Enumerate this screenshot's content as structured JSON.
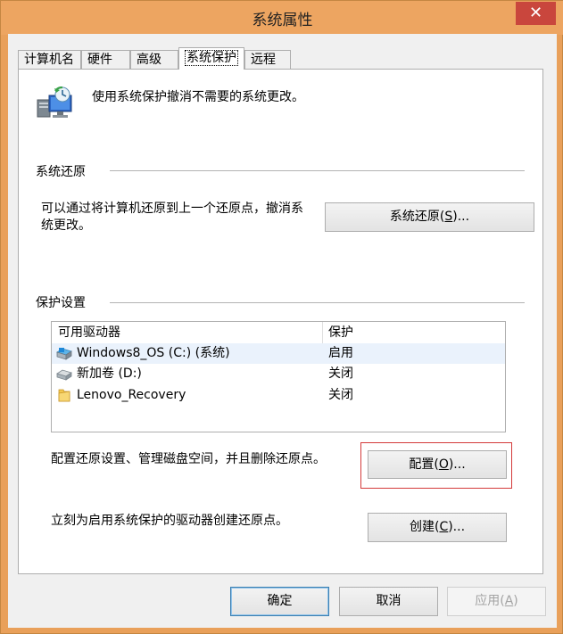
{
  "window": {
    "title": "系统属性",
    "close_glyph": "✕"
  },
  "tabs": [
    {
      "label": "计算机名"
    },
    {
      "label": "硬件"
    },
    {
      "label": "高级"
    },
    {
      "label": "系统保护",
      "active": true
    },
    {
      "label": "远程"
    }
  ],
  "intro": {
    "text": "使用系统保护撤消不需要的系统更改。",
    "icon": "system-protection-icon"
  },
  "restore_group": {
    "title": "系统还原",
    "desc_line1": "可以通过将计算机还原到上一个还原点，撤消系",
    "desc_line2": "统更改。",
    "button_prefix": "系统还原(",
    "button_key": "S",
    "button_suffix": ")..."
  },
  "protect_group": {
    "title": "保护设置",
    "columns": {
      "drive": "可用驱动器",
      "protection": "保护"
    },
    "rows": [
      {
        "name": "Windows8_OS (C:) (系统)",
        "status": "启用",
        "icon": "system-drive-icon"
      },
      {
        "name": "新加卷 (D:)",
        "status": "关闭",
        "icon": "hard-drive-icon"
      },
      {
        "name": "Lenovo_Recovery",
        "status": "关闭",
        "icon": "folder-icon"
      }
    ],
    "config_desc": "配置还原设置、管理磁盘空间，并且删除还原点。",
    "config_prefix": "配置(",
    "config_key": "O",
    "config_suffix": ")...",
    "create_desc": "立刻为启用系统保护的驱动器创建还原点。",
    "create_prefix": "创建(",
    "create_key": "C",
    "create_suffix": ")..."
  },
  "footer": {
    "ok": "确定",
    "cancel": "取消",
    "apply_prefix": "应用(",
    "apply_key": "A",
    "apply_suffix": ")"
  },
  "colors": {
    "title_bar": "#eda561",
    "close": "#c9463d",
    "highlight_box": "#d43a3a",
    "selected_row": "#eaf2fc"
  }
}
